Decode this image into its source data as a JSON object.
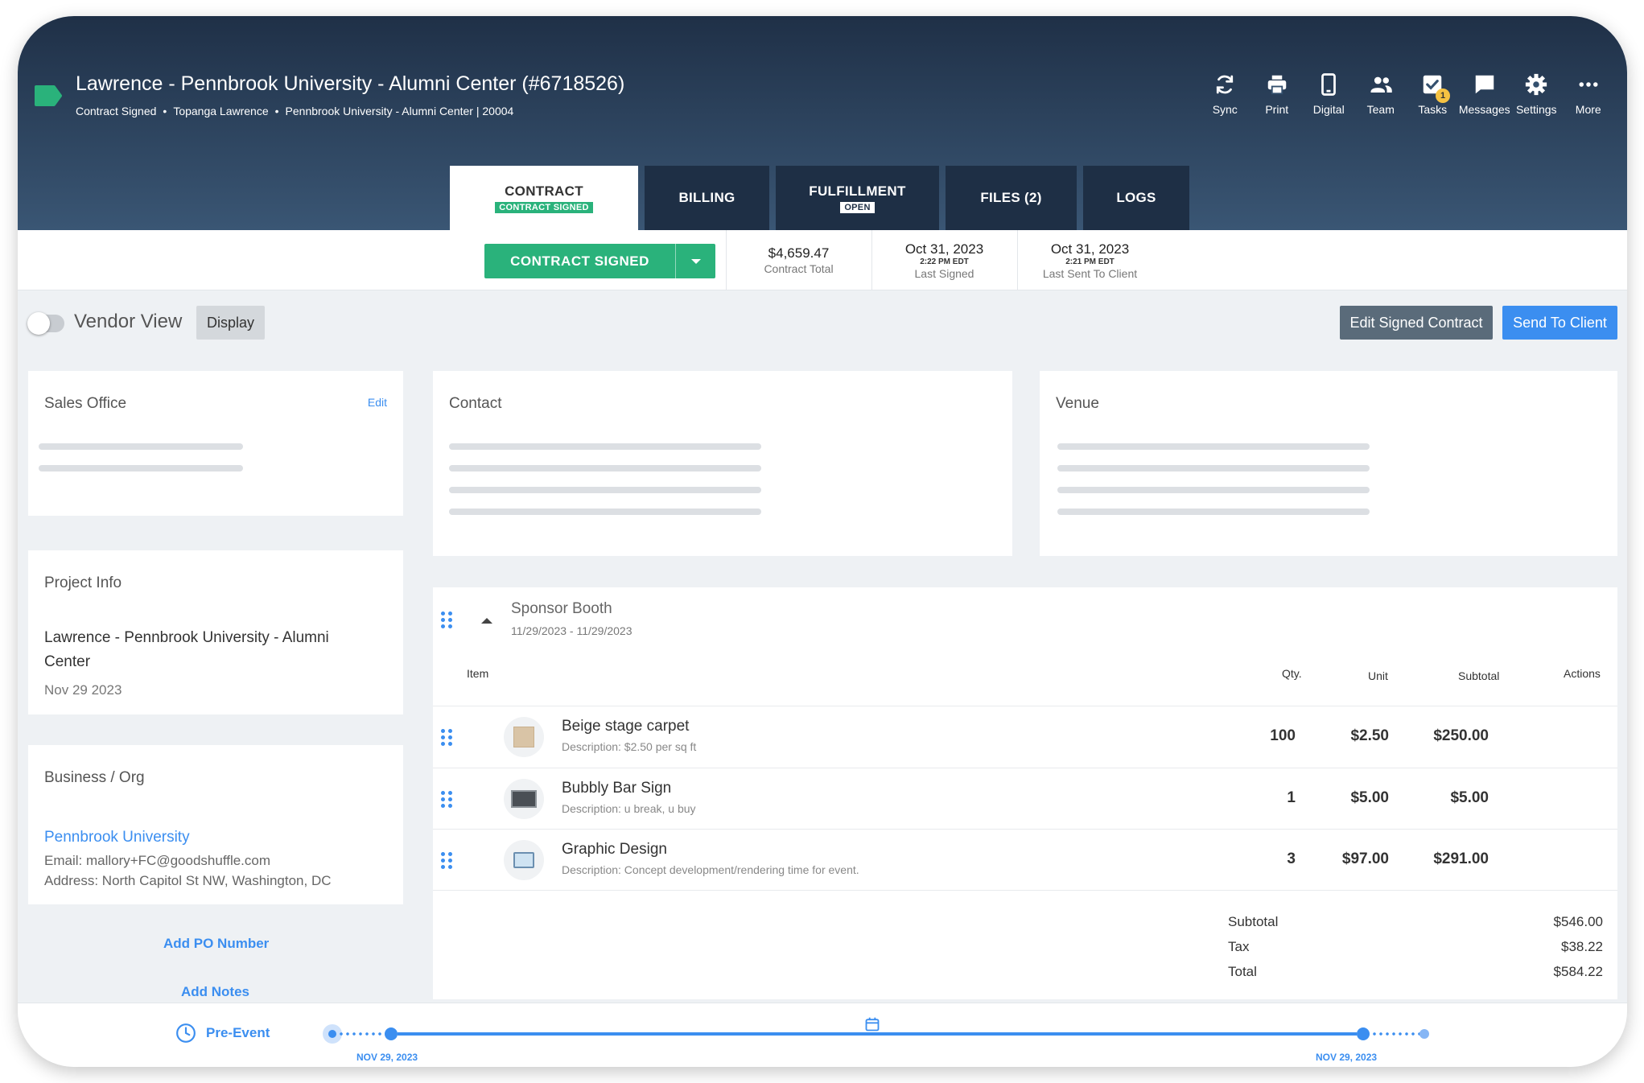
{
  "colors": {
    "header_dark": "#1f3047",
    "accent_green": "#2ab27b",
    "accent_blue": "#3b8ef0",
    "tag_green": "#2ab27b",
    "badge_yellow": "#f5c242"
  },
  "header": {
    "title": "Lawrence - Pennbrook University - Alumni Center (#6718526)",
    "meta": [
      "Contract Signed",
      "Topanga Lawrence",
      "Pennbrook University - Alumni Center | 20004"
    ],
    "separator": "•"
  },
  "toolbar": {
    "items": [
      {
        "label": "Sync",
        "icon": "sync-icon"
      },
      {
        "label": "Print",
        "icon": "print-icon"
      },
      {
        "label": "Digital",
        "icon": "tablet-icon"
      },
      {
        "label": "Team",
        "icon": "team-icon"
      },
      {
        "label": "Tasks",
        "icon": "tasks-icon",
        "badge": "1"
      },
      {
        "label": "Messages",
        "icon": "messages-icon"
      },
      {
        "label": "Settings",
        "icon": "gear-icon"
      },
      {
        "label": "More",
        "icon": "more-icon"
      }
    ]
  },
  "tabs": [
    {
      "label": "CONTRACT",
      "chip": "CONTRACT SIGNED",
      "active": true
    },
    {
      "label": "BILLING"
    },
    {
      "label": "FULFILLMENT",
      "chip": "OPEN"
    },
    {
      "label": "FILES (2)"
    },
    {
      "label": "LOGS"
    }
  ],
  "status_bar": {
    "button_label": "CONTRACT SIGNED",
    "contract_total": {
      "value": "$4,659.47",
      "label": "Contract Total"
    },
    "last_signed": {
      "date": "Oct 31, 2023",
      "time": "2:22 PM EDT",
      "label": "Last Signed"
    },
    "last_sent": {
      "date": "Oct 31, 2023",
      "time": "2:21 PM EDT",
      "label": "Last Sent To Client"
    }
  },
  "view_bar": {
    "vendor_view_label": "Vendor View",
    "display_label": "Display",
    "edit_signed_label": "Edit Signed Contract",
    "send_label": "Send To Client"
  },
  "sales_office": {
    "title": "Sales Office",
    "edit_label": "Edit"
  },
  "contact": {
    "title": "Contact"
  },
  "venue": {
    "title": "Venue"
  },
  "project_info": {
    "title": "Project Info",
    "name": "Lawrence - Pennbrook University - Alumni Center",
    "date": "Nov 29 2023"
  },
  "business": {
    "title": "Business / Org",
    "name": "Pennbrook University",
    "email": "Email: mallory+FC@goodshuffle.com",
    "address": "Address: North Capitol St NW, Washington, DC"
  },
  "sidebar_links": {
    "add_po": "Add PO Number",
    "add_notes": "Add Notes"
  },
  "section": {
    "title": "Sponsor Booth",
    "dates": "11/29/2023 - 11/29/2023",
    "columns": {
      "item": "Item",
      "qty": "Qty.",
      "unit": "Unit",
      "subtotal": "Subtotal",
      "actions": "Actions"
    },
    "rows": [
      {
        "name": "Beige stage carpet",
        "description": "Description: $2.50 per sq ft",
        "qty": "100",
        "unit": "$2.50",
        "subtotal": "$250.00",
        "thumb": "carpet-thumbnail"
      },
      {
        "name": "Bubbly Bar Sign",
        "description": "Description: u break, u buy",
        "qty": "1",
        "unit": "$5.00",
        "subtotal": "$5.00",
        "thumb": "sign-thumbnail"
      },
      {
        "name": "Graphic Design",
        "description": "Description: Concept development/rendering time for event.",
        "qty": "3",
        "unit": "$97.00",
        "subtotal": "$291.00",
        "thumb": "design-thumbnail"
      }
    ],
    "totals": [
      {
        "label": "Subtotal",
        "value": "$546.00"
      },
      {
        "label": "Tax",
        "value": "$38.22"
      },
      {
        "label": "Total",
        "value": "$584.22"
      }
    ]
  },
  "timeline": {
    "phase_label": "Pre-Event",
    "start_date": "NOV 29, 2023",
    "end_date": "NOV 29, 2023"
  }
}
